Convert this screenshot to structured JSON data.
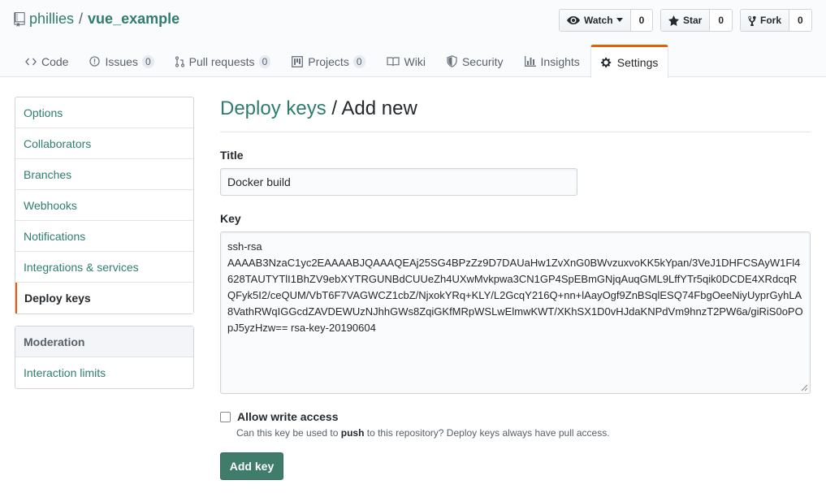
{
  "repo": {
    "owner": "phillies",
    "separator": "/",
    "name": "vue_example"
  },
  "actions": {
    "watch": {
      "label": "Watch",
      "count": "0"
    },
    "star": {
      "label": "Star",
      "count": "0"
    },
    "fork": {
      "label": "Fork",
      "count": "0"
    }
  },
  "tabs": [
    {
      "label": "Code",
      "icon": "code-icon"
    },
    {
      "label": "Issues",
      "count": "0",
      "icon": "issue-icon"
    },
    {
      "label": "Pull requests",
      "count": "0",
      "icon": "pull-request-icon"
    },
    {
      "label": "Projects",
      "count": "0",
      "icon": "project-icon"
    },
    {
      "label": "Wiki",
      "icon": "book-icon"
    },
    {
      "label": "Security",
      "icon": "shield-icon"
    },
    {
      "label": "Insights",
      "icon": "graph-icon"
    },
    {
      "label": "Settings",
      "icon": "gear-icon",
      "selected": true
    }
  ],
  "sidebar": {
    "items": [
      {
        "label": "Options"
      },
      {
        "label": "Collaborators"
      },
      {
        "label": "Branches"
      },
      {
        "label": "Webhooks"
      },
      {
        "label": "Notifications"
      },
      {
        "label": "Integrations & services"
      },
      {
        "label": "Deploy keys",
        "selected": true
      }
    ],
    "moderation": {
      "heading": "Moderation",
      "items": [
        {
          "label": "Interaction limits"
        }
      ]
    }
  },
  "main": {
    "heading_link": "Deploy keys",
    "heading_rest": " / Add new",
    "title_label": "Title",
    "title_value": "Docker build",
    "key_label": "Key",
    "key_value": "ssh-rsa\nAAAAB3NzaC1yc2EAAAABJQAAAQEAj25SG4BPzZz9D7DAUaHw1ZvXnG0BWvzuxvoKK5kYpan/3VeJ1DHFCSAyW1Fl4628TAUTYTlI1BhZV9ebXYTRGUNBdCUUeZh4UXwMvkpwa3CN1GP4SpEBmGNjqAuqGML9LffYTr5qik0DCDE4XRdcqRQFyk5I2/ceQUM/VbT6F7VAGWCZ1cbZ/NjxokYRq+KLY/L2GcqY216Q+nn+lAayOgf9ZnBSqlESQ74FbgOeeNiyUyprGyhLA8VathRWqIGGcdZAVDEWUzNJhhGWs8ZqiGKfMRpWSLwElmwKWT/XKhSX1D0vHJdaKNPdVm9hnzT2PW6a/giRiS0oPOpJ5yzHzw== rsa-key-20190604",
    "allow_write_label": "Allow write access",
    "note_prefix": "Can this key be used to ",
    "note_bold": "push",
    "note_suffix": " to this repository? Deploy keys always have pull access.",
    "submit_label": "Add key"
  },
  "colors": {
    "link": "#2f7d6f",
    "button": "#3f7c69",
    "tab_accent": "#e36209"
  }
}
